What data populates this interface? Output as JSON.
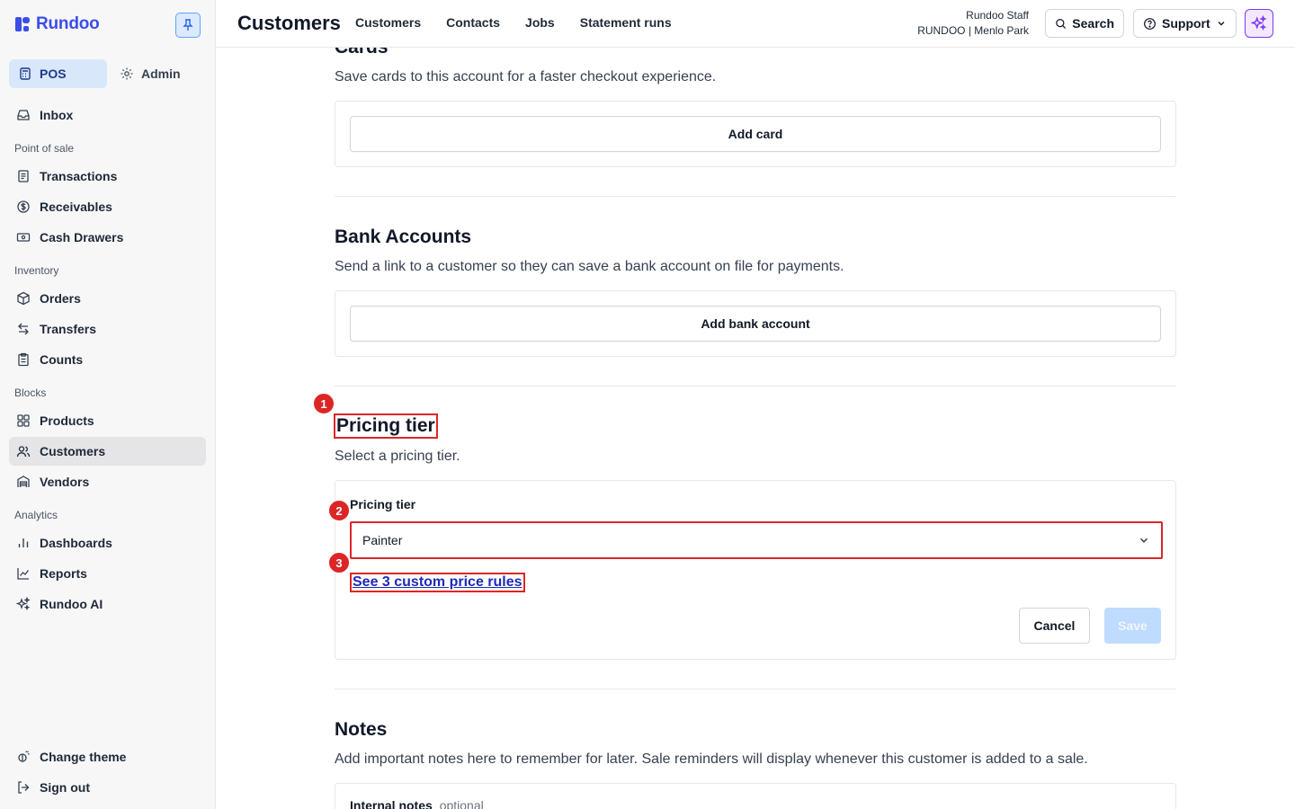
{
  "app": {
    "brand": "Rundoo"
  },
  "sidebar": {
    "modes": [
      {
        "label": "POS"
      },
      {
        "label": "Admin"
      }
    ],
    "inbox": "Inbox",
    "sections": [
      {
        "title": "Point of sale",
        "items": [
          "Transactions",
          "Receivables",
          "Cash Drawers"
        ]
      },
      {
        "title": "Inventory",
        "items": [
          "Orders",
          "Transfers",
          "Counts"
        ]
      },
      {
        "title": "Blocks",
        "items": [
          "Products",
          "Customers",
          "Vendors"
        ]
      },
      {
        "title": "Analytics",
        "items": [
          "Dashboards",
          "Reports",
          "Rundoo AI"
        ]
      }
    ],
    "bottom": [
      "Change theme",
      "Sign out"
    ]
  },
  "header": {
    "title": "Customers",
    "tabs": [
      "Customers",
      "Contacts",
      "Jobs",
      "Statement runs"
    ],
    "user_name": "Rundoo Staff",
    "store": "RUNDOO | Menlo Park",
    "search_label": "Search",
    "support_label": "Support"
  },
  "cards_section": {
    "title": "Cards",
    "description": "Save cards to this account for a faster checkout experience.",
    "button": "Add card"
  },
  "bank_section": {
    "title": "Bank Accounts",
    "description": "Send a link to a customer so they can save a bank account on file for payments.",
    "button": "Add bank account"
  },
  "pricing_section": {
    "title": "Pricing tier",
    "description": "Select a pricing tier.",
    "field_label": "Pricing tier",
    "selected_value": "Painter",
    "link": "See 3 custom price rules",
    "cancel_label": "Cancel",
    "save_label": "Save"
  },
  "notes_section": {
    "title": "Notes",
    "description": "Add important notes here to remember for later. Sale reminders will display whenever this customer is added to a sale.",
    "field_label": "Internal notes",
    "field_hint": "optional"
  },
  "markers": [
    "1",
    "2",
    "3"
  ],
  "colors": {
    "accent": "#3b4ee8",
    "highlight": "#dc2626",
    "link": "#1d2ab8"
  }
}
